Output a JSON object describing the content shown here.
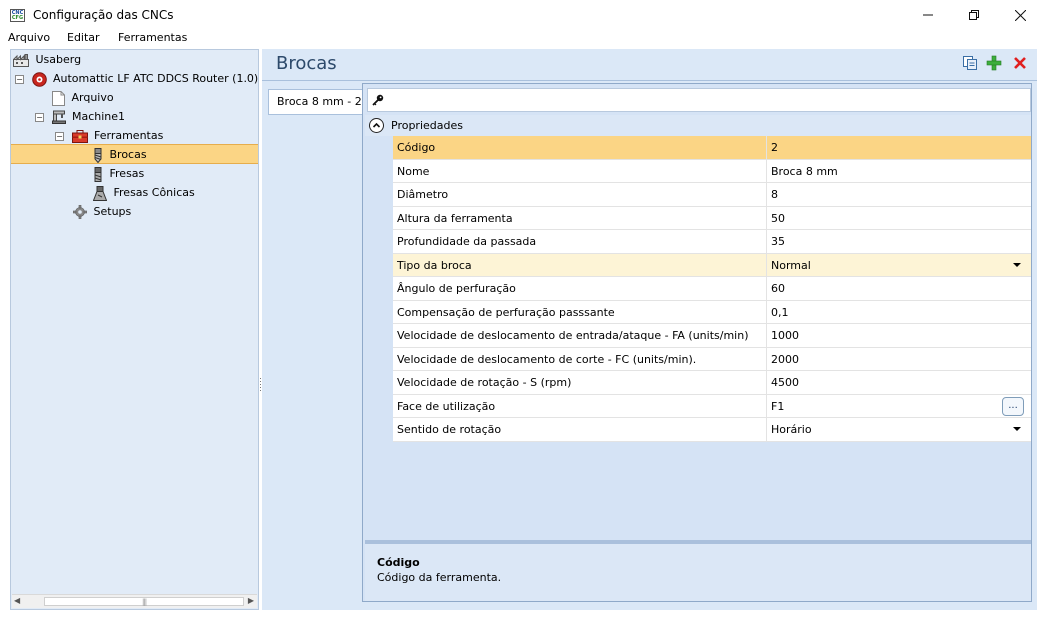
{
  "window": {
    "title": "Configuração das CNCs",
    "app_icon_top": "CNC",
    "app_icon_bottom": "CFG"
  },
  "menu": [
    "Arquivo",
    "Editar",
    "Ferramentas"
  ],
  "tree": {
    "root": "Usaberg",
    "machine_config": "Automattic LF ATC DDCS Router (1.0)",
    "arquivo": "Arquivo",
    "machine": "Machine1",
    "ferramentas": "Ferramentas",
    "brocas": "Brocas",
    "fresas": "Fresas",
    "fresas_conicas": "Fresas Cônicas",
    "setups": "Setups"
  },
  "panel": {
    "title": "Brocas",
    "tab": "Broca 8 mm - 2",
    "category": "Propriedades",
    "search_placeholder": ""
  },
  "properties": [
    {
      "name": "Código",
      "value": "2"
    },
    {
      "name": "Nome",
      "value": "Broca 8 mm"
    },
    {
      "name": "Diâmetro",
      "value": "8"
    },
    {
      "name": "Altura da ferramenta",
      "value": "50"
    },
    {
      "name": "Profundidade da passada",
      "value": "35"
    },
    {
      "name": "Tipo da broca",
      "value": "Normal"
    },
    {
      "name": "Ângulo de perfuração",
      "value": "60"
    },
    {
      "name": "Compensação de perfuração passsante",
      "value": "0,1"
    },
    {
      "name": "Velocidade de deslocamento de entrada/ataque - FA (units/min)",
      "value": "1000"
    },
    {
      "name": "Velocidade de deslocamento de corte - FC (units/min).",
      "value": "2000"
    },
    {
      "name": "Velocidade de rotação - S (rpm)",
      "value": "4500"
    },
    {
      "name": "Face de utilização",
      "value": "F1"
    },
    {
      "name": "Sentido de rotação",
      "value": "Horário"
    }
  ],
  "ellipsis_label": "...",
  "description": {
    "title": "Código",
    "text": "Código da ferramenta."
  },
  "colors": {
    "selection": "#fbd585",
    "panel_bg": "#dbe8f7",
    "delete_red": "#e02020",
    "add_green": "#3cae3c"
  }
}
